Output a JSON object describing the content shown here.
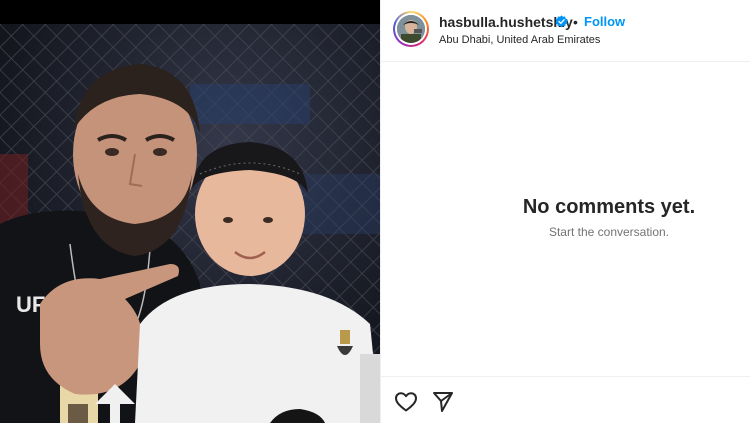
{
  "post": {
    "username": "hasbulla.hushetskiy",
    "verified": true,
    "separator": "•",
    "follow_label": "Follow",
    "location": "Abu Dhabi, United Arab Emirates",
    "media_alt": "Photo of two people in front of a fighting cage"
  },
  "comments": {
    "empty_title": "No comments yet.",
    "empty_subtitle": "Start the conversation."
  },
  "actions": {
    "like_icon": "heart-icon",
    "share_icon": "paper-plane-icon"
  },
  "colors": {
    "link_blue": "#0095f6",
    "verified_blue": "#0095f6",
    "text_primary": "#262626",
    "text_secondary": "#737373",
    "divider": "#efefef"
  }
}
